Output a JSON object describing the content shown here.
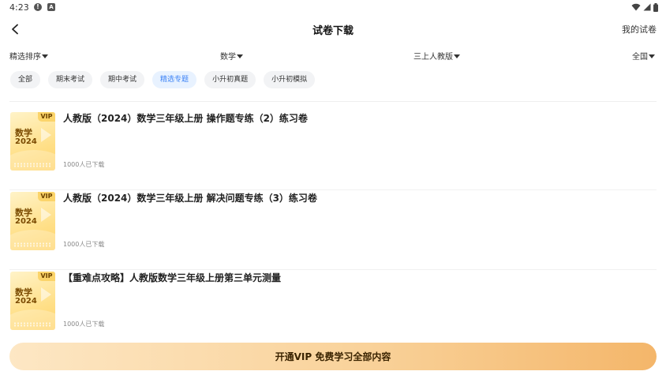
{
  "status_bar": {
    "time": "4:23",
    "alert_glyph": "!",
    "app_glyph": "A"
  },
  "nav": {
    "title": "试卷下载",
    "right_link": "我的试卷"
  },
  "filters": {
    "sort": "精选排序",
    "subject": "数学",
    "edition": "三上人教版",
    "region": "全国"
  },
  "tags": [
    {
      "label": "全部",
      "active": false
    },
    {
      "label": "期末考试",
      "active": false
    },
    {
      "label": "期中考试",
      "active": false
    },
    {
      "label": "精选专题",
      "active": true
    },
    {
      "label": "小升初真题",
      "active": false
    },
    {
      "label": "小升初模拟",
      "active": false
    }
  ],
  "items": [
    {
      "title": "人教版（2024）数学三年级上册 操作题专练（2）练习卷",
      "count": "1000人已下载",
      "thumb": {
        "vip": "VIP",
        "subject": "数学",
        "year": "2024"
      }
    },
    {
      "title": "人教版（2024）数学三年级上册 解决问题专练（3）练习卷",
      "count": "1000人已下载",
      "thumb": {
        "vip": "VIP",
        "subject": "数学",
        "year": "2024"
      }
    },
    {
      "title": "【重难点攻略】人教版数学三年级上册第三单元测量",
      "count": "1000人已下载",
      "thumb": {
        "vip": "VIP",
        "subject": "数学",
        "year": "2024"
      }
    }
  ],
  "vip_banner": {
    "label": "开通VIP 免费学习全部内容"
  },
  "colors": {
    "accent": "#3b82f6",
    "vip_gold": "#f4b66a",
    "tag_bg": "#f2f3f5"
  },
  "icons": {
    "back": "chevron-left-icon",
    "wifi": "wifi-icon",
    "signal": "signal-icon",
    "battery": "battery-icon"
  }
}
